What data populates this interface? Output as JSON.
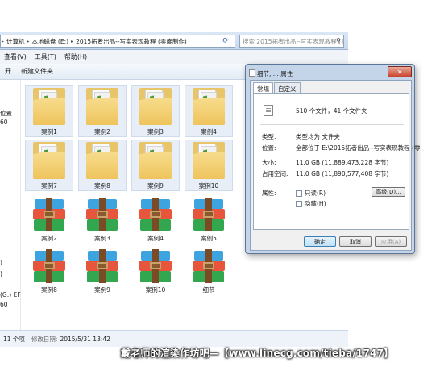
{
  "explorer": {
    "breadcrumb": [
      "计算机",
      "本地磁盘 (E:)",
      "2015拓者出品--写实表现教程 (零度制作)"
    ],
    "search_placeholder": "搜索 2015拓者出品--写实表现教程 (零度制作)",
    "menu": [
      "查看(V)",
      "工具(T)",
      "帮助(H)"
    ],
    "toolbar": [
      "开",
      "新建文件夹"
    ],
    "nav_items": [
      "位置",
      "60",
      ")",
      ")",
      "(G:) EF",
      "60"
    ],
    "folders": [
      "案例1",
      "案例2",
      "案例3",
      "案例4",
      "案例7",
      "案例8",
      "案例9",
      "案例10"
    ],
    "archives": [
      "案例2",
      "案例3",
      "案例4",
      "案例5",
      "案例8",
      "案例9",
      "案例10",
      "细节"
    ],
    "status": {
      "count": "11 个项",
      "modified_label": "修改日期:",
      "modified_value": "2015/5/31 13:42"
    }
  },
  "dialog": {
    "title": "细节, ... 属性",
    "tabs": [
      "常规",
      "自定义"
    ],
    "summary": "510 个文件，41 个文件夹",
    "rows": [
      {
        "key": "类型:",
        "value": "类型均为 文件夹"
      },
      {
        "key": "位置:",
        "value": "全部位于 E:\\2015拓者出品--写实表现教程 (零"
      },
      {
        "key": "大小:",
        "value": "11.0 GB (11,889,473,228 字节)"
      },
      {
        "key": "占用空间:",
        "value": "11.0 GB (11,890,577,408 字节)"
      }
    ],
    "attributes_label": "属性:",
    "checkboxes": [
      "只读(R)",
      "隐藏(H)"
    ],
    "advanced_button": "高级(D)...",
    "ok_button": "确定",
    "cancel_button": "取消",
    "apply_button": "应用(A)"
  },
  "watermark": "戴老师的渲染作坊吧—【www.linecg.com/tieba/1747】"
}
